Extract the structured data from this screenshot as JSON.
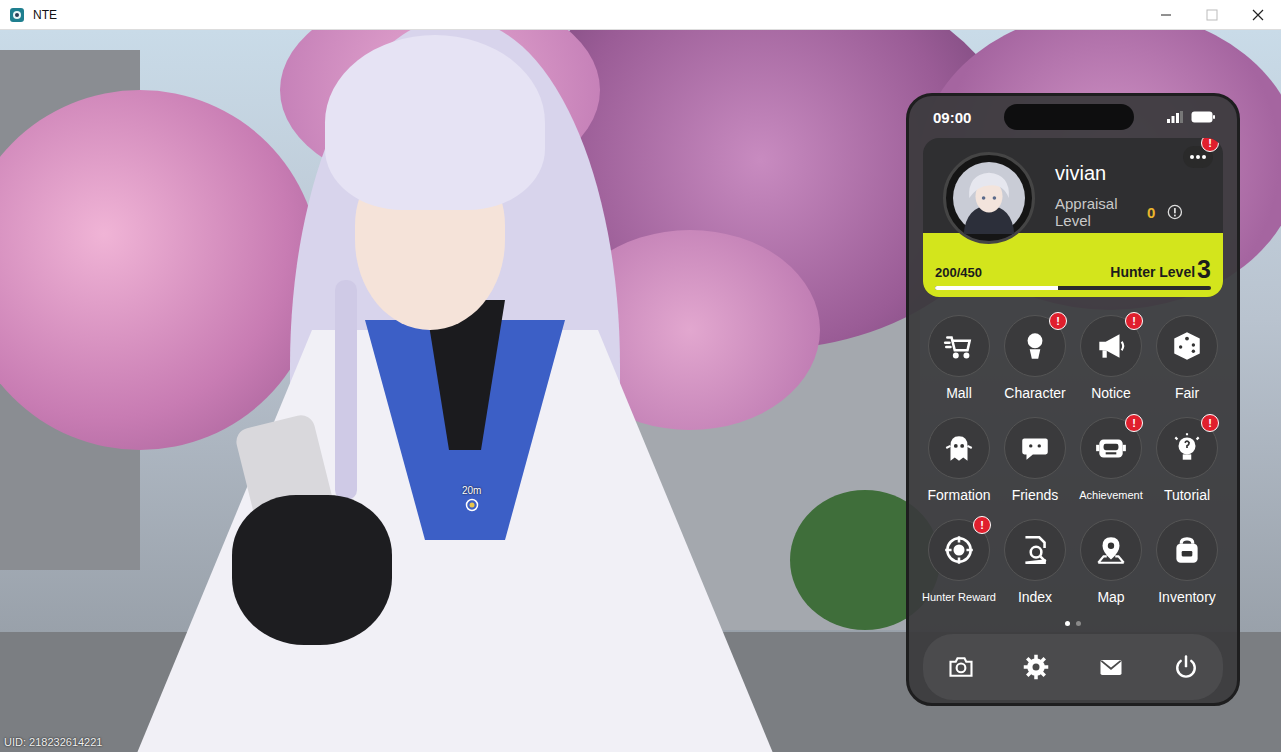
{
  "window": {
    "title": "NTE"
  },
  "scene": {
    "uid": "UID: 218232614221",
    "marker": "20m"
  },
  "phone": {
    "time": "09:00",
    "alert_mark": "!",
    "menu_alert": true,
    "profile": {
      "name": "vivian",
      "appraisal_label": "Appraisal Level",
      "appraisal_value": "0",
      "exp": "200/450",
      "hunter_label": "Hunter Level",
      "hunter_value": "3",
      "level": 0.444
    },
    "apps": [
      {
        "label": "Mall",
        "alert": false
      },
      {
        "label": "Character",
        "alert": true
      },
      {
        "label": "Notice",
        "alert": true
      },
      {
        "label": "Fair",
        "alert": false
      },
      {
        "label": "Formation",
        "alert": false
      },
      {
        "label": "Friends",
        "alert": false
      },
      {
        "label": "Achievement",
        "alert": true
      },
      {
        "label": "Tutorial",
        "alert": true
      },
      {
        "label": "Hunter Reward",
        "alert": true
      },
      {
        "label": "Index",
        "alert": false
      },
      {
        "label": "Map",
        "alert": false
      },
      {
        "label": "Inventory",
        "alert": false
      }
    ],
    "pages": [
      {
        "selected": true
      },
      {
        "selected": false
      }
    ]
  }
}
